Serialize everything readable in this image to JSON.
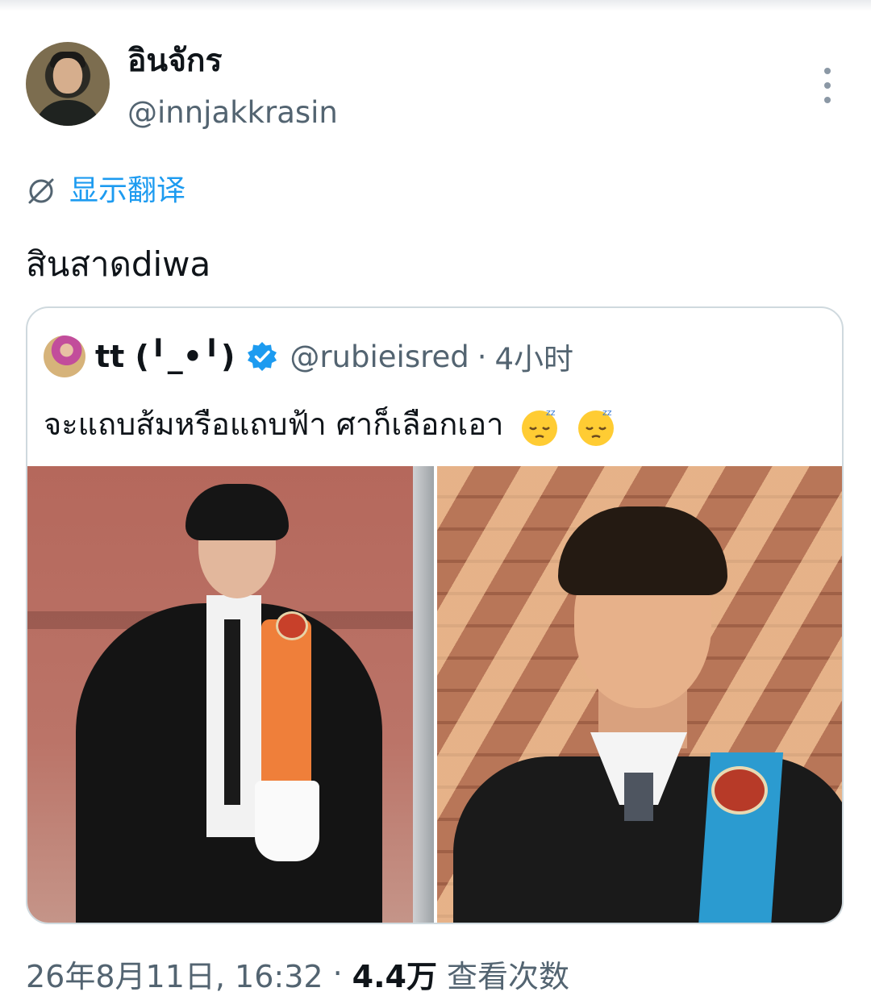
{
  "author": {
    "display_name": "อินจักร",
    "handle": "@innjakkrasin"
  },
  "translate": {
    "icon": "translate-icon",
    "label": "显示翻译"
  },
  "tweet": {
    "text": "สินสาดdiwa"
  },
  "quoted_tweet": {
    "display_name": "tt (╹_•╹)",
    "verified": true,
    "handle": "@rubieisred",
    "separator": "·",
    "time": "4小时",
    "text": "จะแถบส้มหรือแถบฟ้า ศาก็เลือกเอา",
    "emojis": [
      "sleepy-face",
      "sleepy-face"
    ],
    "photos": [
      {
        "description_icon": "photo-graduate-orange-sash"
      },
      {
        "description_icon": "photo-graduate-blue-sash"
      }
    ]
  },
  "meta": {
    "timestamp": "26年8月11日, 16:32",
    "separator": "·",
    "views_count": "4.4万",
    "views_label": "查看次数"
  },
  "colors": {
    "link": "#1d9bf0",
    "secondary_text": "#536471",
    "primary_text": "#0f1419",
    "border": "#cfd9de",
    "verified": "#1d9bf0"
  }
}
